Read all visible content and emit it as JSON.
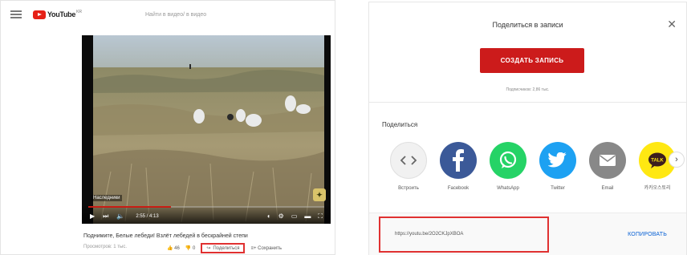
{
  "left_panel": {
    "header": {
      "brand": "YouTube",
      "region": "KR",
      "search_placeholder": "Найти в видео/ в видео"
    },
    "player": {
      "caption": "Наследники",
      "time": "2:55 / 4:13",
      "progress_fraction": 0.35
    },
    "video": {
      "title": "Поднимите, Белые лебеди! Взлёт лебедей в бескрайней степи",
      "meta": "Просмотров: 1 тыс.",
      "likes": "46",
      "dislikes": "0",
      "share_label": "Поделиться",
      "save_label": "Сохранить"
    }
  },
  "share_dialog": {
    "title": "Поделиться в записи",
    "create_button": "СОЗДАТЬ ЗАПИСЬ",
    "note": "Подписчиков: 2,86 тыс.",
    "section_label": "Поделиться",
    "targets": [
      {
        "label": "Встроить",
        "icon": "embed-icon",
        "color": "#f1f1f1"
      },
      {
        "label": "Facebook",
        "icon": "facebook-icon",
        "color": "#3b5998"
      },
      {
        "label": "WhatsApp",
        "icon": "whatsapp-icon",
        "color": "#25d366"
      },
      {
        "label": "Twitter",
        "icon": "twitter-icon",
        "color": "#1da1f2"
      },
      {
        "label": "Email",
        "icon": "email-icon",
        "color": "#888888"
      },
      {
        "label": "카카오스토리",
        "icon": "kakaotalk-icon",
        "color": "#ffe812"
      }
    ],
    "link_url": "https://youtu.be/2O2CKJpXBOA",
    "copy_button": "КОПИРОВАТЬ",
    "brand_colors": {
      "accent": "#cc1b1b",
      "highlight": "#e03131",
      "link": "#065fd4"
    }
  }
}
